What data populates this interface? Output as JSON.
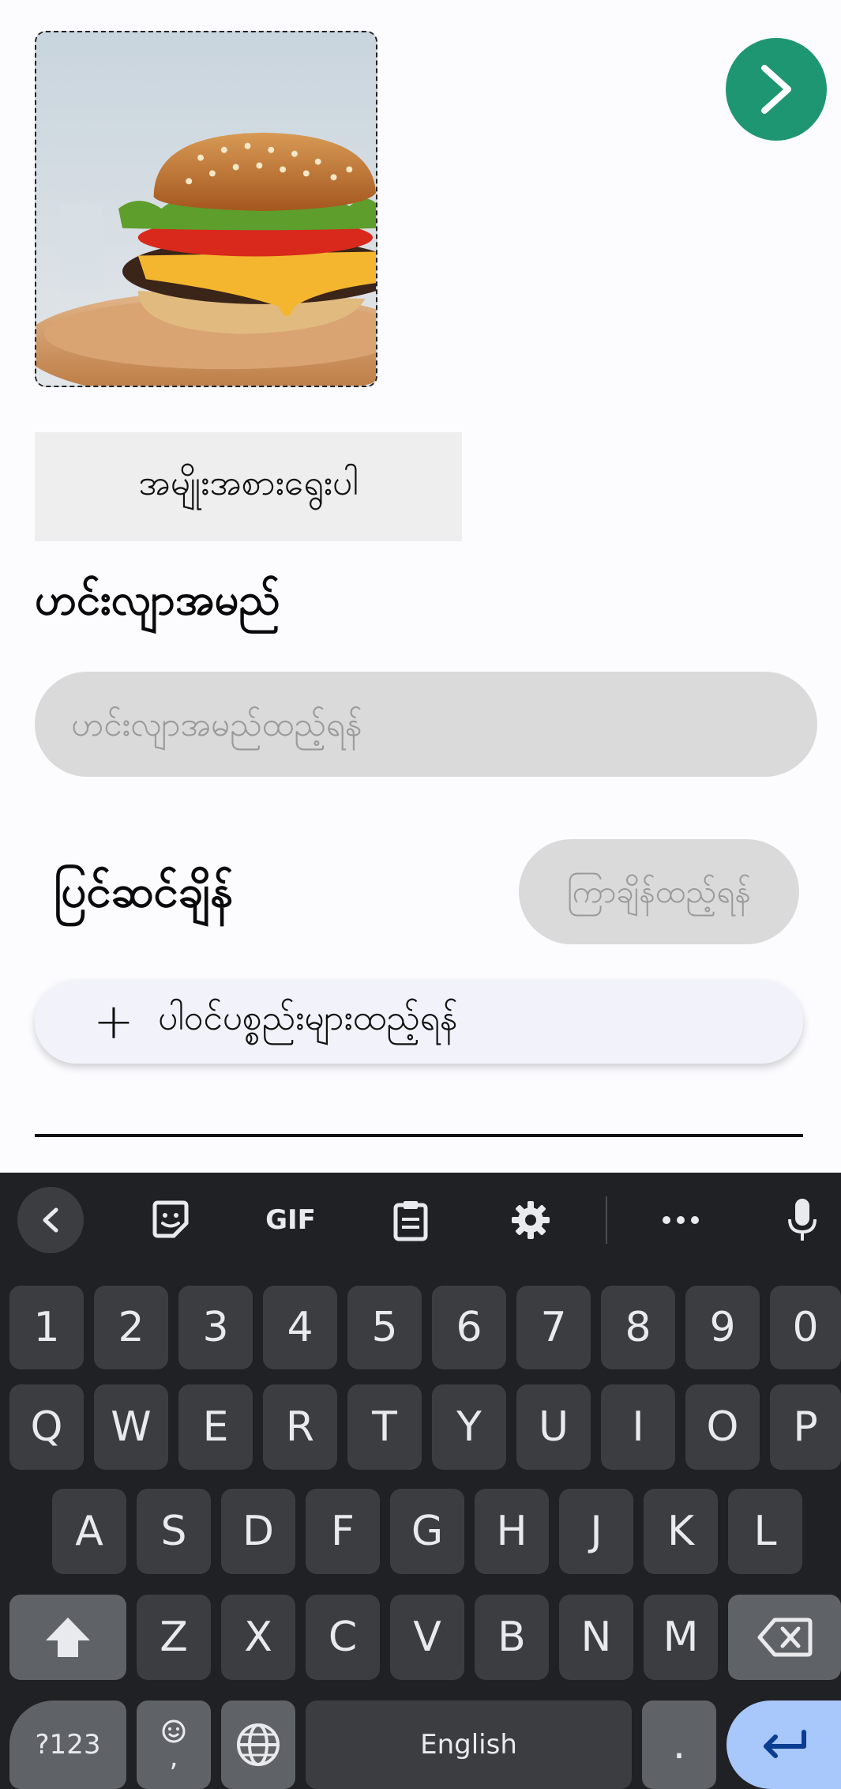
{
  "form": {
    "select_type_label": "အမျိုးအစားရွေးပါ",
    "dish_name_title": "ဟင်းလျာအမည်",
    "dish_name_placeholder": "ဟင်းလျာအမည်ထည့်ရန်",
    "cook_time_label": "ပြင်ဆင်ချိန်",
    "cook_time_placeholder": "ကြာချိန်ထည့်ရန်",
    "add_ingredients_label": "ပါဝင်ပစ္စည်းများထည့်ရန်"
  },
  "colors": {
    "accent": "#1f9672",
    "keyboard_bg": "#202124",
    "key_bg": "#3c3d41",
    "enter_bg": "#a8c7fa"
  },
  "keyboard": {
    "toolbar": [
      "back-icon",
      "sticker-icon",
      "gif-icon",
      "clipboard-icon",
      "settings-icon",
      "more-icon",
      "mic-icon"
    ],
    "gif_label": "GIF",
    "row_numbers": [
      "1",
      "2",
      "3",
      "4",
      "5",
      "6",
      "7",
      "8",
      "9",
      "0"
    ],
    "row_top": [
      "Q",
      "W",
      "E",
      "R",
      "T",
      "Y",
      "U",
      "I",
      "O",
      "P"
    ],
    "row_middle": [
      "A",
      "S",
      "D",
      "F",
      "G",
      "H",
      "J",
      "K",
      "L"
    ],
    "row_bottom": [
      "Z",
      "X",
      "C",
      "V",
      "B",
      "N",
      "M"
    ],
    "symbols_label": "?123",
    "comma_label": ",",
    "space_label": "English",
    "period_label": "."
  }
}
